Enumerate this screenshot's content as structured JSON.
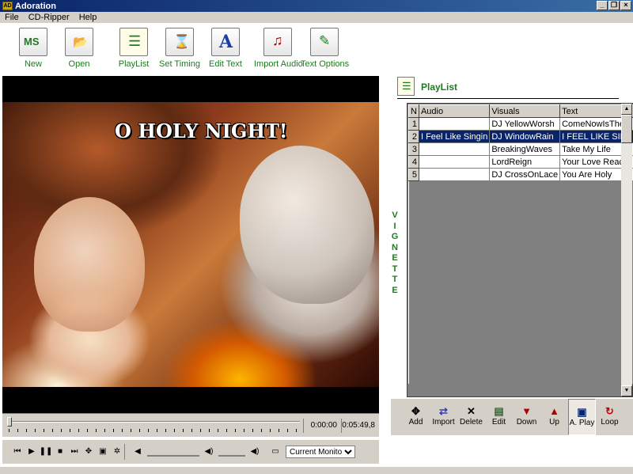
{
  "window": {
    "title": "Adoration",
    "app_icon_text": "AD"
  },
  "menu": [
    "File",
    "CD-Ripper",
    "Help"
  ],
  "toolbar": [
    {
      "label": "New",
      "icon": "new-ms-icon",
      "glyph": "MS"
    },
    {
      "label": "Open",
      "icon": "folder-open-icon",
      "glyph": "📂"
    },
    {
      "label": "PlayList",
      "icon": "playlist-icon",
      "glyph": "☰"
    },
    {
      "label": "Set Timing",
      "icon": "hourglass-icon",
      "glyph": "⌛"
    },
    {
      "label": "Edit Text",
      "icon": "edit-text-icon",
      "glyph": "A"
    },
    {
      "label": "Import Audio",
      "icon": "import-audio-icon",
      "glyph": "♫"
    },
    {
      "label": "Text Options",
      "icon": "text-options-icon",
      "glyph": "✎"
    }
  ],
  "video": {
    "headline": "O HOLY NIGHT!"
  },
  "seek": {
    "current_time": "0:00:00",
    "total_time": "0:05:49,8"
  },
  "controls": {
    "monitor_select": "Current Monitor"
  },
  "vignette_label": "VIGNETTE",
  "playlist": {
    "title": "PlayList",
    "columns": [
      "N",
      "Audio",
      "Visuals",
      "Text"
    ],
    "rows": [
      {
        "n": "1",
        "audio": "",
        "visuals": "DJ YellowWorsh",
        "text": "ComeNowIsTheT"
      },
      {
        "n": "2",
        "audio": "I Feel Like Singin",
        "visuals": "DJ WindowRain",
        "text": "I FEEL LIKE SINC",
        "selected": true
      },
      {
        "n": "3",
        "audio": "",
        "visuals": "BreakingWaves",
        "text": "Take My Life"
      },
      {
        "n": "4",
        "audio": "",
        "visuals": "LordReign",
        "text": "Your Love Reach"
      },
      {
        "n": "5",
        "audio": "",
        "visuals": "DJ CrossOnLace",
        "text": "You Are Holy"
      }
    ],
    "buttons": [
      {
        "label": "Add",
        "glyph": "✥",
        "color": "#000000"
      },
      {
        "label": "Import",
        "glyph": "⇄",
        "color": "#3b3bb0"
      },
      {
        "label": "Delete",
        "glyph": "✕",
        "color": "#000000"
      },
      {
        "label": "Edit",
        "glyph": "▤",
        "color": "#2a6a2a"
      },
      {
        "label": "Down",
        "glyph": "▼",
        "color": "#b00000"
      },
      {
        "label": "Up",
        "glyph": "▲",
        "color": "#b00000"
      },
      {
        "label": "A. Play",
        "glyph": "▣",
        "color": "#0a246a",
        "active": true
      },
      {
        "label": "Loop",
        "glyph": "↻",
        "color": "#cc0000"
      }
    ]
  }
}
